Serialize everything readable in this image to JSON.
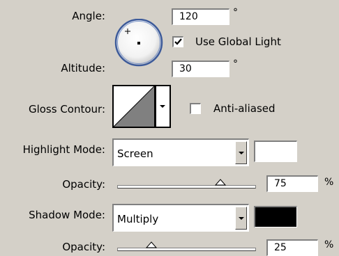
{
  "angle": {
    "label": "Angle:",
    "value": "120",
    "unit": "°"
  },
  "global_light": {
    "label": "Use Global Light",
    "checked": true
  },
  "altitude": {
    "label": "Altitude:",
    "value": "30",
    "unit": "°"
  },
  "gloss_contour": {
    "label": "Gloss Contour:"
  },
  "anti_aliased": {
    "label": "Anti-aliased",
    "checked": false
  },
  "highlight": {
    "mode_label": "Highlight Mode:",
    "mode_value": "Screen",
    "color": "#ffffff",
    "opacity_label": "Opacity:",
    "opacity_value": "75",
    "opacity_unit": "%",
    "opacity_level": 0.75
  },
  "shadow": {
    "mode_label": "Shadow Mode:",
    "mode_value": "Multiply",
    "color": "#000000",
    "opacity_label": "Opacity:",
    "opacity_value": "25",
    "opacity_unit": "%",
    "opacity_level": 0.25
  },
  "icons": [
    "angle-dial-icon",
    "checkmark-icon",
    "gloss-contour-icon",
    "chevron-down-icon",
    "slider-thumb-icon"
  ]
}
